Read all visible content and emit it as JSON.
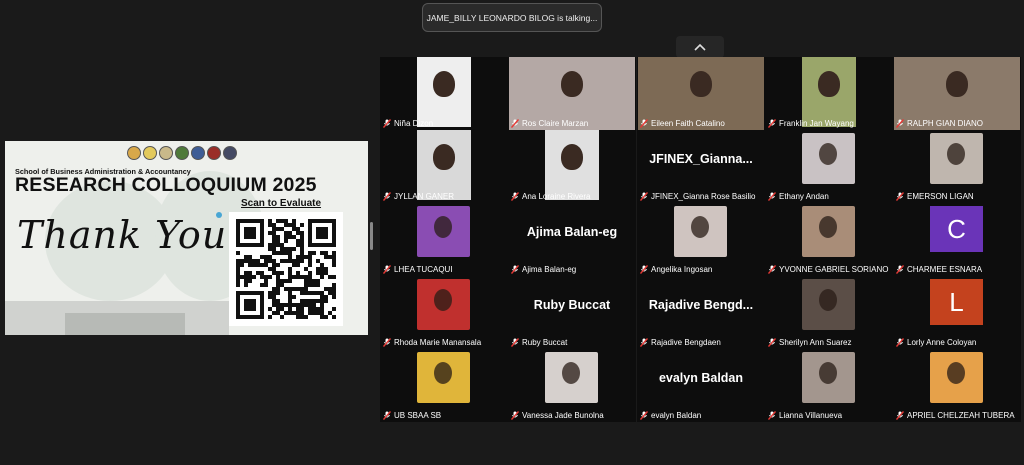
{
  "notification": {
    "speaking": "JAME_BILLY LEONARDO BILOG is talking..."
  },
  "slide": {
    "school": "School of Business Administration & Accountancy",
    "title": "RESEARCH COLLOQUIUM 2025",
    "scan": "Scan to Evaluate",
    "thanks": "Thank You"
  },
  "participants": [
    {
      "name": "Niña Dizon",
      "kind": "photo",
      "color": "#eeeeee"
    },
    {
      "name": "Ros Claire Marzan",
      "kind": "photo",
      "color": "#b4a8a5"
    },
    {
      "name": "Eileen Faith Catalino",
      "kind": "photo",
      "color": "#7d6a55"
    },
    {
      "name": "Franklin Jan Wayang",
      "kind": "photo",
      "color": "#9aa66a"
    },
    {
      "name": "RALPH GIAN DIANO",
      "kind": "photo",
      "color": "#8b7a6a"
    },
    {
      "name": "JYLLAN GANER",
      "kind": "photo",
      "color": "#d9d9d9"
    },
    {
      "name": "Ana Loraine Rivera",
      "kind": "photo",
      "color": "#e0e0e0"
    },
    {
      "name": "JFINEX_Gianna Rose Basilio",
      "kind": "text",
      "display": "JFINEX_Gianna..."
    },
    {
      "name": "Ethany Andan",
      "kind": "avatar",
      "color": "#c9c2c4"
    },
    {
      "name": "EMERSON LIGAN",
      "kind": "avatar",
      "color": "#bfb6ae"
    },
    {
      "name": "LHEA TUCAQUI",
      "kind": "avatar",
      "color": "#8a4db3"
    },
    {
      "name": "Ajima Balan-eg",
      "kind": "text",
      "display": "Ajima Balan-eg"
    },
    {
      "name": "Angelika Ingosan",
      "kind": "avatar",
      "color": "#cfc4c0"
    },
    {
      "name": "YVONNE GABRIEL SORIANO",
      "kind": "avatar",
      "color": "#a98d78"
    },
    {
      "name": "CHARMEE ESNARA",
      "kind": "letter",
      "letter": "C",
      "color": "#6a34b8"
    },
    {
      "name": "Rhoda Marie Manansala",
      "kind": "avatar",
      "color": "#c0302e"
    },
    {
      "name": "Ruby Buccat",
      "kind": "text",
      "display": "Ruby Buccat"
    },
    {
      "name": "Rajadive Bengdaen",
      "kind": "text",
      "display": "Rajadive  Bengd..."
    },
    {
      "name": "Sherilyn Ann Suarez",
      "kind": "avatar",
      "color": "#5b4e47"
    },
    {
      "name": "Lorly Anne Coloyan",
      "kind": "letter",
      "letter": "L",
      "color": "#c4421e"
    },
    {
      "name": "UB SBAA SB",
      "kind": "avatar",
      "color": "#e0b53a"
    },
    {
      "name": "Vanessa Jade Bunolna",
      "kind": "avatar",
      "color": "#d6d0cd"
    },
    {
      "name": "evalyn Baldan",
      "kind": "text",
      "display": "evalyn Baldan"
    },
    {
      "name": "Lianna Villanueva",
      "kind": "avatar",
      "color": "#a3968e"
    },
    {
      "name": "APRIEL CHELZEAH TUBERA",
      "kind": "avatar",
      "color": "#e6a14a"
    }
  ],
  "colors": {
    "muted": "#e53935",
    "background": "#1a1a1a",
    "tile": "#0d0d0d"
  },
  "icons": {
    "mute": "muted-mic-icon",
    "collapse": "chevron-up-icon"
  }
}
